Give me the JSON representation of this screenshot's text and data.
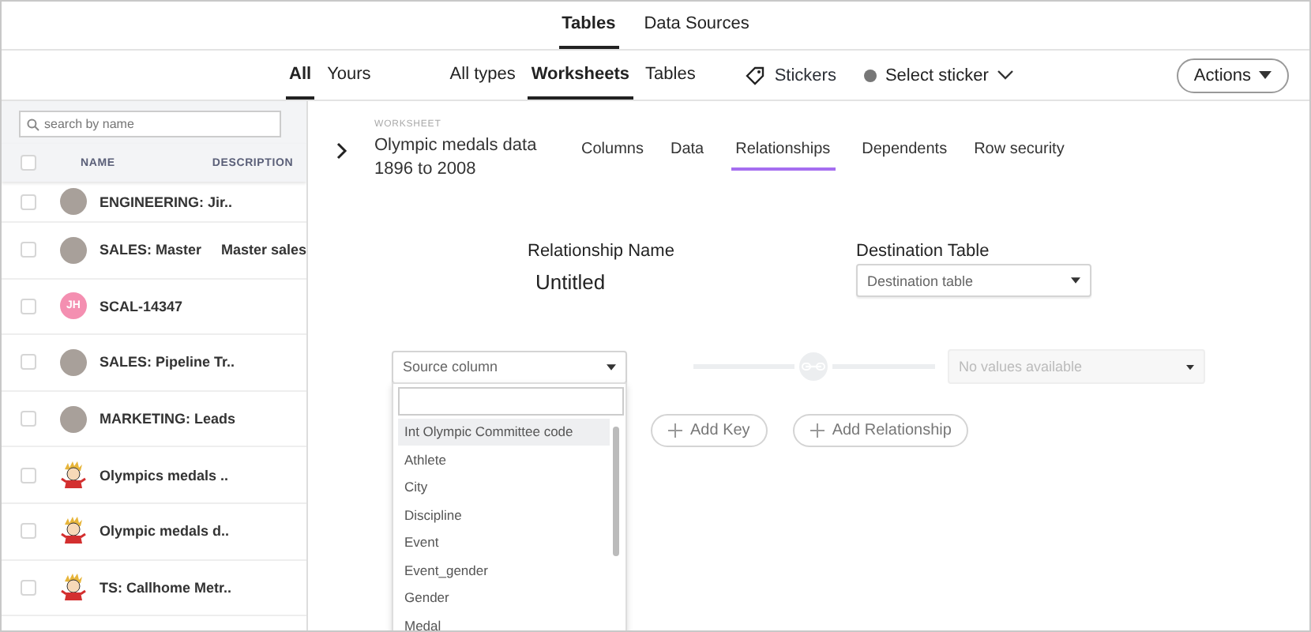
{
  "top_tabs": [
    {
      "label": "Tables",
      "selected": true
    },
    {
      "label": "Data Sources",
      "selected": false
    }
  ],
  "owner_tabs": [
    {
      "label": "All",
      "selected": true
    },
    {
      "label": "Yours",
      "selected": false
    }
  ],
  "type_tabs": [
    {
      "label": "All types",
      "selected": false
    },
    {
      "label": "Worksheets",
      "selected": true
    },
    {
      "label": "Tables",
      "selected": false
    }
  ],
  "stickers": {
    "label": "Stickers",
    "select_label": "Select sticker"
  },
  "actions_button": "Actions",
  "sidebar": {
    "search": {
      "placeholder": "search by name"
    },
    "select_all_checked": false,
    "columns": [
      "NAME",
      "DESCRIPTION"
    ],
    "rows": [
      {
        "kind": "photo",
        "name": "ENGINEERING: Jir..",
        "description": "",
        "checked": false
      },
      {
        "kind": "photo",
        "name": "SALES: Master",
        "description": "Master sales",
        "checked": false
      },
      {
        "kind": "initials",
        "initials": "JH",
        "name": "SCAL-14347",
        "description": "",
        "checked": false
      },
      {
        "kind": "photo",
        "name": "SALES: Pipeline Tr..",
        "description": "",
        "checked": false
      },
      {
        "kind": "photo",
        "name": "MARKETING: Leads",
        "description": "",
        "checked": false
      },
      {
        "kind": "cartoon",
        "name": "Olympics medals ..",
        "description": "",
        "checked": false
      },
      {
        "kind": "cartoon",
        "name": "Olympic medals d..",
        "description": "",
        "checked": false
      },
      {
        "kind": "cartoon",
        "name": "TS: Callhome Metr..",
        "description": "",
        "checked": false
      }
    ]
  },
  "worksheet": {
    "kind_label": "WORKSHEET",
    "title": "Olympic medals data 1896 to 2008",
    "tabs": [
      {
        "label": "Columns",
        "selected": false
      },
      {
        "label": "Data",
        "selected": false
      },
      {
        "label": "Relationships",
        "selected": true
      },
      {
        "label": "Dependents",
        "selected": false
      },
      {
        "label": "Row security",
        "selected": false
      }
    ]
  },
  "relationship": {
    "name_label": "Relationship Name",
    "name_value": "Untitled",
    "destination_label": "Destination Table",
    "destination_placeholder": "Destination table",
    "source_placeholder": "Source column",
    "target_placeholder": "No values available",
    "source_options": [
      {
        "label": "Int Olympic Committee code",
        "selected": true
      },
      {
        "label": "Athlete",
        "selected": false
      },
      {
        "label": "City",
        "selected": false
      },
      {
        "label": "Discipline",
        "selected": false
      },
      {
        "label": "Event",
        "selected": false
      },
      {
        "label": "Event_gender",
        "selected": false
      },
      {
        "label": "Gender",
        "selected": false
      },
      {
        "label": "Medal",
        "selected": false
      }
    ],
    "buttons": [
      "Add Key",
      "Add Relationship"
    ]
  }
}
